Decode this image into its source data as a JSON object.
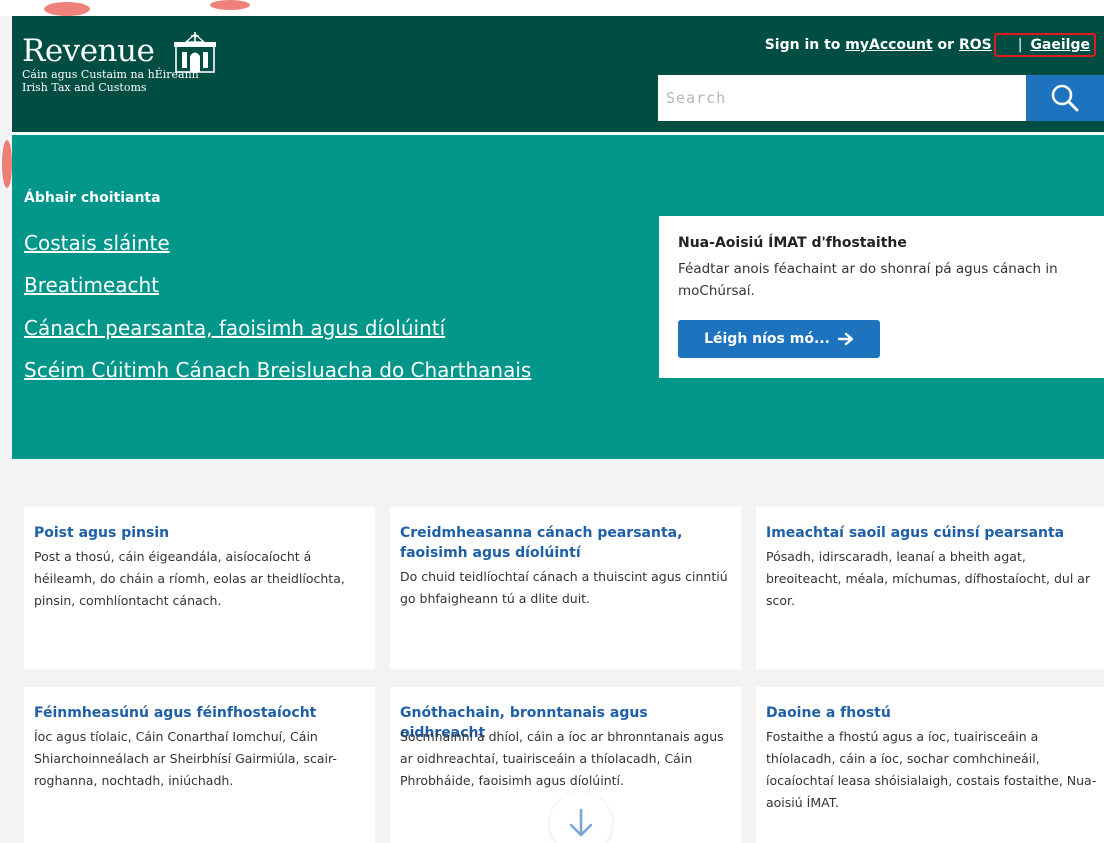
{
  "header": {
    "logo_word": "Revenue",
    "logo_sub_ga": "Cáin agus Custaim na hÉireann",
    "logo_sub_en": "Irish Tax and Customs",
    "signin_prefix": "Sign in to",
    "myaccount_link": "myAccount",
    "or_text": "or",
    "ros_link": "ROS",
    "separator": "|",
    "gaeilge_link": "Gaeilge",
    "search_placeholder": "Search",
    "colors": {
      "header_bg": "#004d44",
      "search_button": "#1e73be",
      "highlight_box": "#e01b1b"
    },
    "icons": {
      "emblem": "harp-building-emblem-icon",
      "search": "search-icon"
    }
  },
  "hero": {
    "heading": "Ábhair choitianta",
    "links": [
      "Costais sláinte",
      "Breatimeacht",
      "Cánach pearsanta, faoisimh agus díolúintí",
      "Scéim Cúitimh Cánach Breisluacha do Charthanais"
    ],
    "bg_color": "#00968a"
  },
  "promo": {
    "title": "Nua-Aoisiú ÍMAT d'fhostaithe",
    "text": "Féadtar anois féachaint ar do shonraí pá agus cánach in moChúrsaí.",
    "button_label": "Léigh níos mó...",
    "button_icon": "arrow-right-icon"
  },
  "cards": [
    {
      "title": "Poist agus pinsin",
      "desc": "Post a thosú, cáin éigeandála, aisíocaíocht á héileamh, do cháin a ríomh, eolas ar theidlíochta, pinsin, comhlíontacht cánach."
    },
    {
      "title": "Creidmheasanna cánach pearsanta, faoisimh agus díolúintí",
      "desc": "Do chuid teidlíochtaí cánach a thuiscint agus cinntiú go bhfaigheann tú a dlite duit."
    },
    {
      "title": "Imeachtaí saoil agus cúinsí pearsanta",
      "desc": "Pósadh, idirscaradh, leanaí a bheith agat, breoiteacht, méala, míchumas, dífhostaíocht, dul ar scor."
    },
    {
      "title": "Féinmheasúnú agus féinfhostaíocht",
      "desc": "Íoc agus tíolaic, Cáin Conarthaí Iomchuí, Cáin Shiarchoinneálach ar Sheirbhísí Gairmiúla, scair-roghanna, nochtadh, iniúchadh."
    },
    {
      "title": "Gnóthachain, bronntanais agus oidhreacht",
      "desc": "Sócmhainní a dhíol, cáin a íoc ar bhronntanais agus ar oidhreachtaí, tuairisceáin a thíolacadh, Cáin Phrobháide, faoisimh agus díolúintí."
    },
    {
      "title": "Daoine a fhostú",
      "desc": "Fostaithe a fhostú agus a íoc, tuairisceáin a thíolacadh, cáin a íoc, sochar comhchineáil, íocaíochtaí leasa shóisialaigh, costais fostaithe, Nua-aoisiú ÍMAT."
    }
  ],
  "scroll_icon": "arrow-down-icon"
}
